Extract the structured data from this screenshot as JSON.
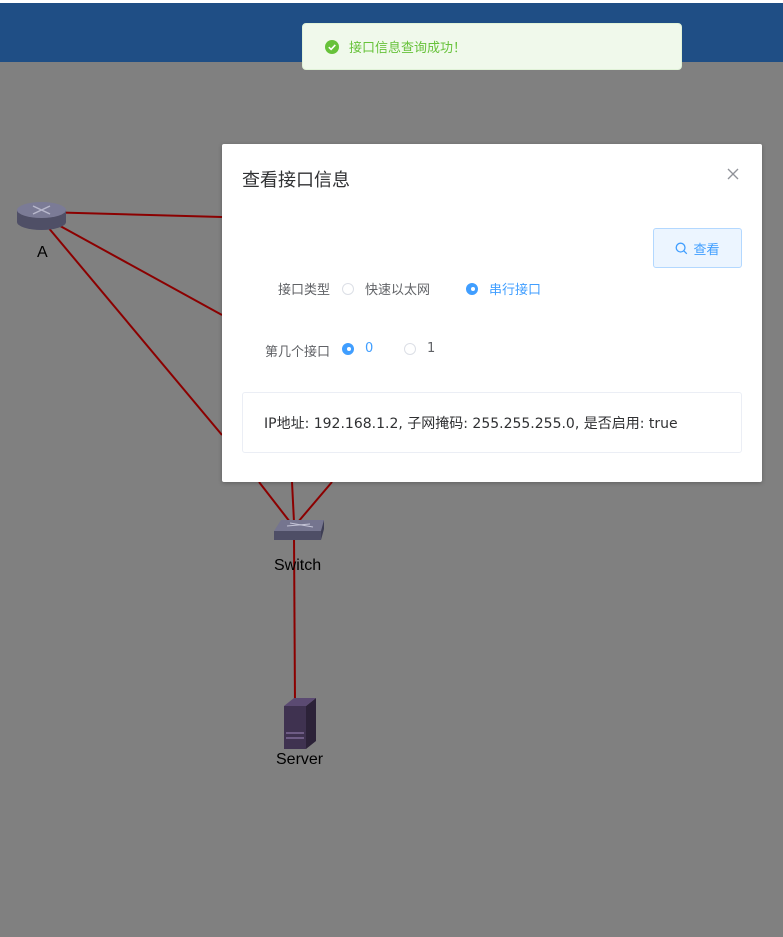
{
  "toast": {
    "message": "接口信息查询成功！"
  },
  "topology": {
    "nodes": [
      {
        "name": "A",
        "icon": "router-icon"
      },
      {
        "name": "Switch",
        "icon": "switch-icon"
      },
      {
        "name": "Server",
        "icon": "server-icon"
      }
    ],
    "link_color": "#8b0000"
  },
  "dialog": {
    "title": "查看接口信息",
    "query_button": "查看",
    "interface_type_label": "接口类型",
    "interface_type_options": [
      "快速以太网",
      "串行接口"
    ],
    "interface_type_selected": "串行接口",
    "interface_index_label": "第几个接口",
    "interface_index_options": [
      "0",
      "1"
    ],
    "interface_index_selected": "0",
    "result": "IP地址: 192.168.1.2, 子网掩码: 255.255.255.0, 是否启用: true"
  },
  "colors": {
    "header": "#1f4e85",
    "overlay": "#808080",
    "primary": "#409eff",
    "success": "#67c23a"
  }
}
